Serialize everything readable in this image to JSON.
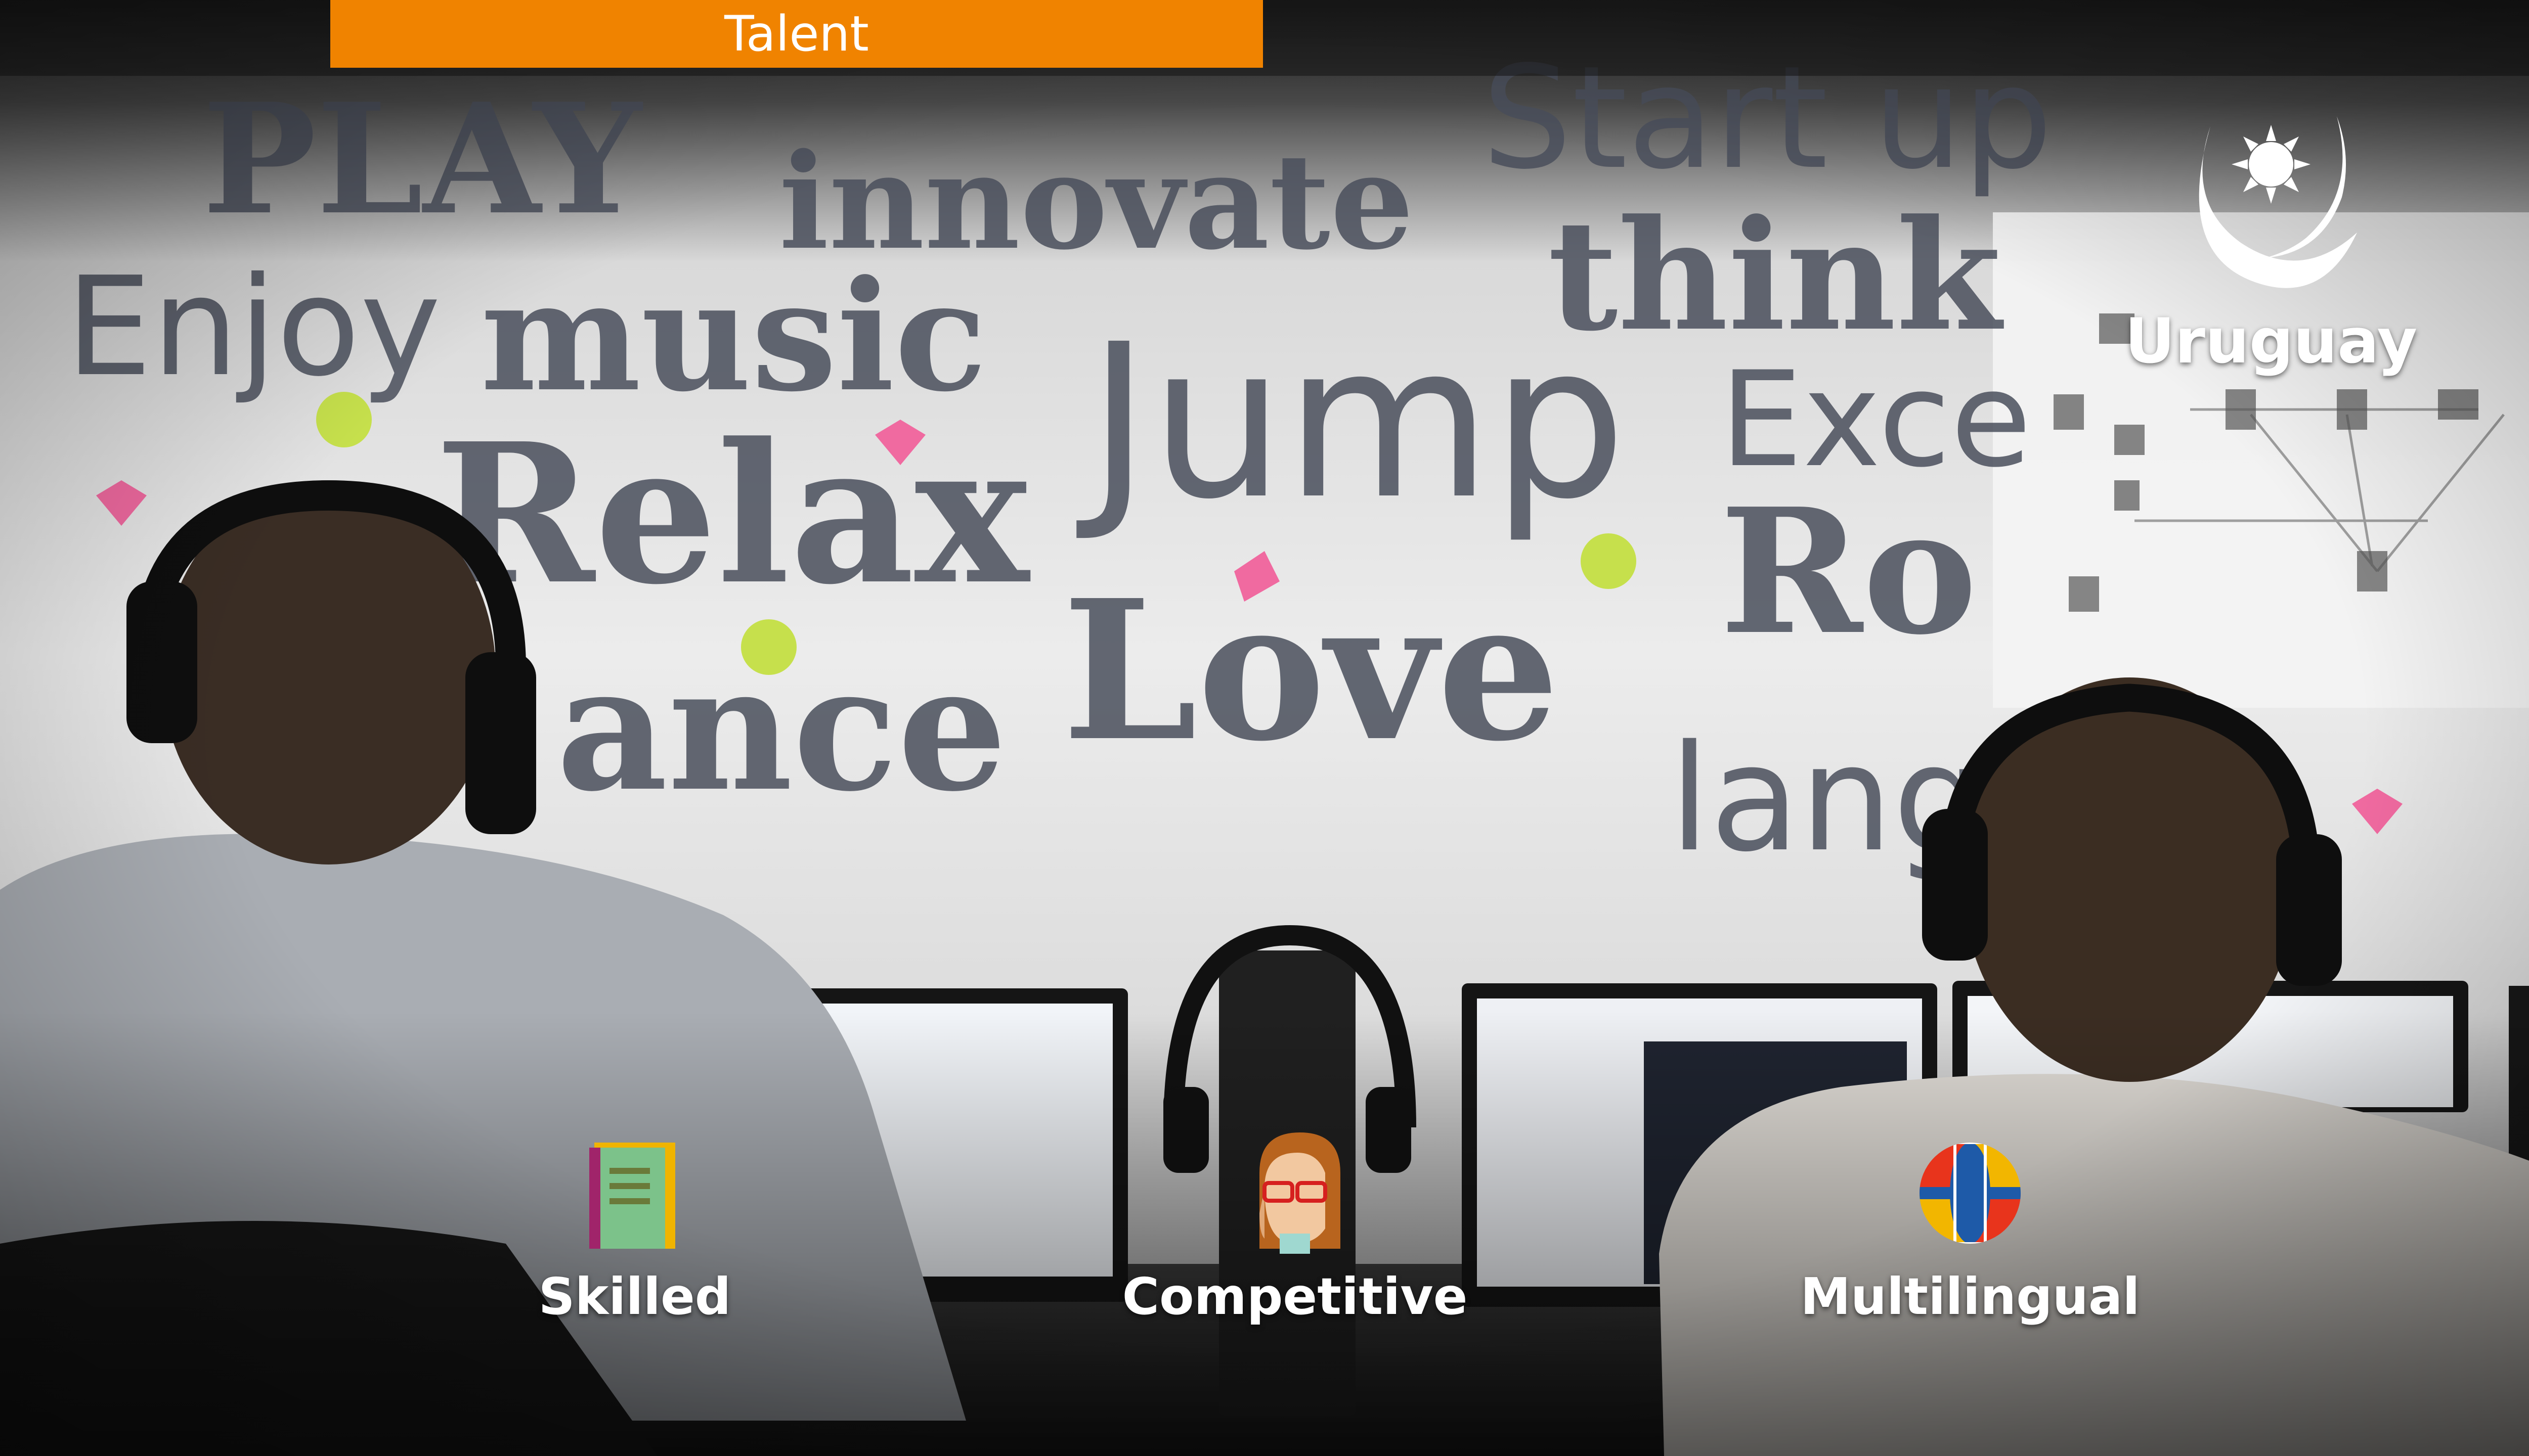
{
  "header": {
    "tab_label": "Talent",
    "accent_color": "#f08300"
  },
  "brand": {
    "country": "Uruguay",
    "logo_icon": "sun-crescent-logo-icon"
  },
  "background": {
    "description_icon": "office-photo-background"
  },
  "features": [
    {
      "label": "Skilled",
      "icon": "book-icon"
    },
    {
      "label": "Competitive",
      "icon": "person-glasses-icon"
    },
    {
      "label": "Multilingual",
      "icon": "multicolor-globe-icon"
    }
  ],
  "wall_words": [
    "PLAY",
    "innovate",
    "Start up",
    "Enjoy",
    "music",
    "think",
    "Jump",
    "Exce",
    "Relax",
    "Ro",
    "Love",
    "ance",
    "lang",
    "start"
  ]
}
